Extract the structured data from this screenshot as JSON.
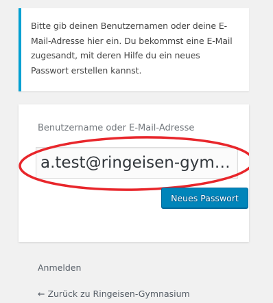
{
  "notice": {
    "lines": [
      "Bitte gib deinen Benutzernamen oder deine E-",
      "Mail-Adresse hier ein. Du bekommst eine E-Mail",
      "zugesandt, mit deren Hilfe du ein neues",
      "Passwort erstellen kannst."
    ]
  },
  "form": {
    "label": "Benutzername oder E-Mail-Adresse",
    "value": "a.test@ringeisen-gymnasium.de",
    "submit_label": "Neues Passwort"
  },
  "nav": {
    "login_label": "Anmelden",
    "back_label": "← Zurück zu Ringeisen-Gymnasium"
  },
  "colors": {
    "notice_border": "#00a0d2",
    "button_bg": "#0085ba",
    "highlight": "#e8262b"
  }
}
